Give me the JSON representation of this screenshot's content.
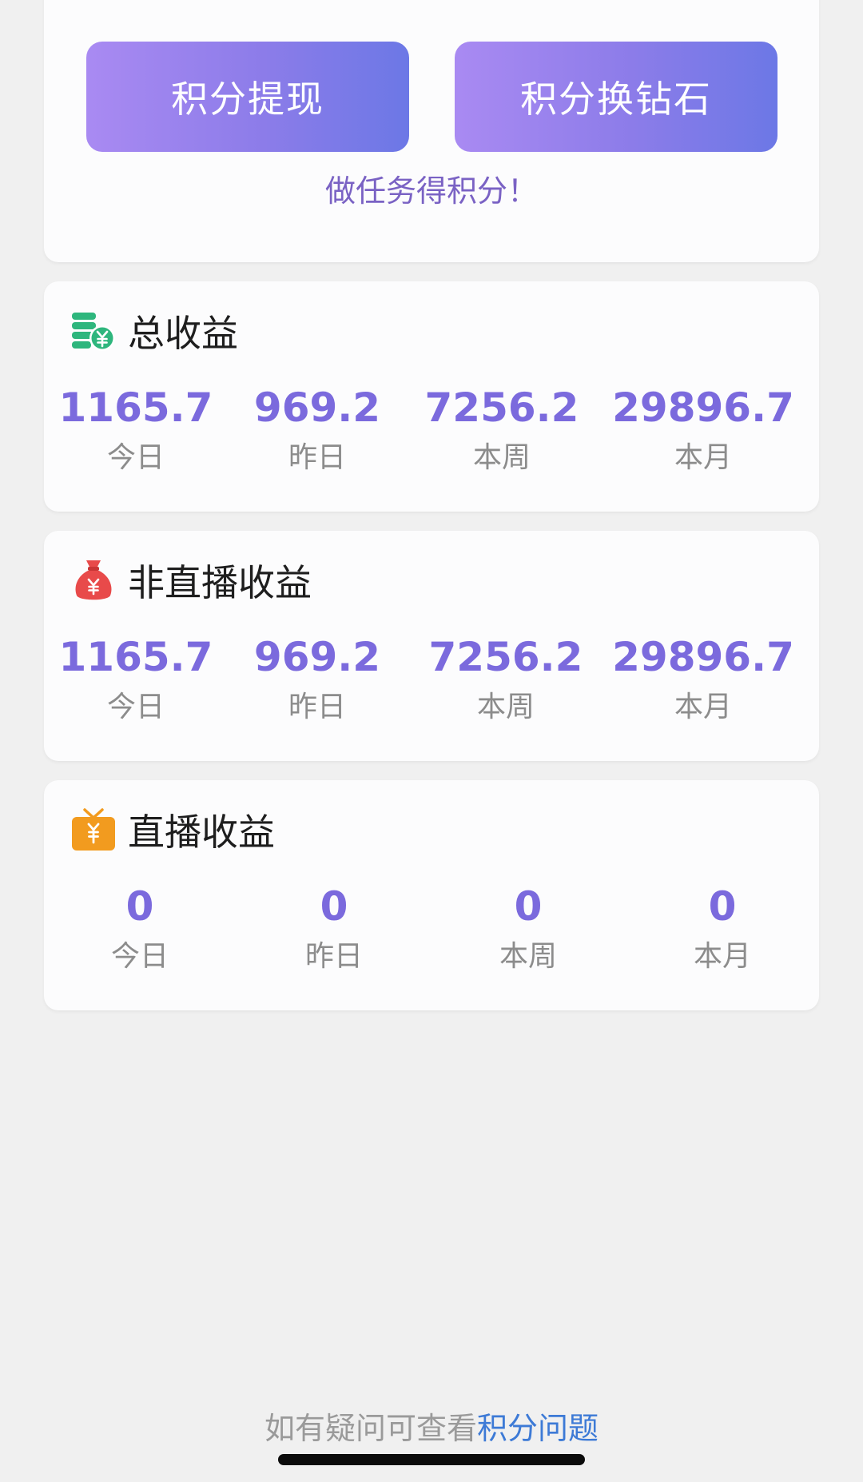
{
  "actions": {
    "withdraw_label": "积分提现",
    "exchange_label": "积分换钻石",
    "task_link": "做任务得积分！"
  },
  "sections": [
    {
      "title": "总收益",
      "icon": "coins-yuan-icon",
      "stats": [
        {
          "value": "1165.7",
          "label": "今日"
        },
        {
          "value": "969.2",
          "label": "昨日"
        },
        {
          "value": "7256.2",
          "label": "本周"
        },
        {
          "value": "29896.7",
          "label": "本月"
        }
      ]
    },
    {
      "title": "非直播收益",
      "icon": "money-bag-icon",
      "stats": [
        {
          "value": "1165.7",
          "label": "今日"
        },
        {
          "value": "969.2",
          "label": "昨日"
        },
        {
          "value": "7256.2",
          "label": "本周"
        },
        {
          "value": "29896.7",
          "label": "本月"
        }
      ]
    },
    {
      "title": "直播收益",
      "icon": "tv-yuan-icon",
      "stats": [
        {
          "value": "0",
          "label": "今日"
        },
        {
          "value": "0",
          "label": "昨日"
        },
        {
          "value": "0",
          "label": "本周"
        },
        {
          "value": "0",
          "label": "本月"
        }
      ]
    }
  ],
  "footer": {
    "prefix": "如有疑问可查看",
    "link": "积分问题"
  },
  "colors": {
    "accent": "#7b6add",
    "link": "#3d7ad6",
    "button_gradient_start": "#a98af2",
    "button_gradient_end": "#6c78e6"
  }
}
